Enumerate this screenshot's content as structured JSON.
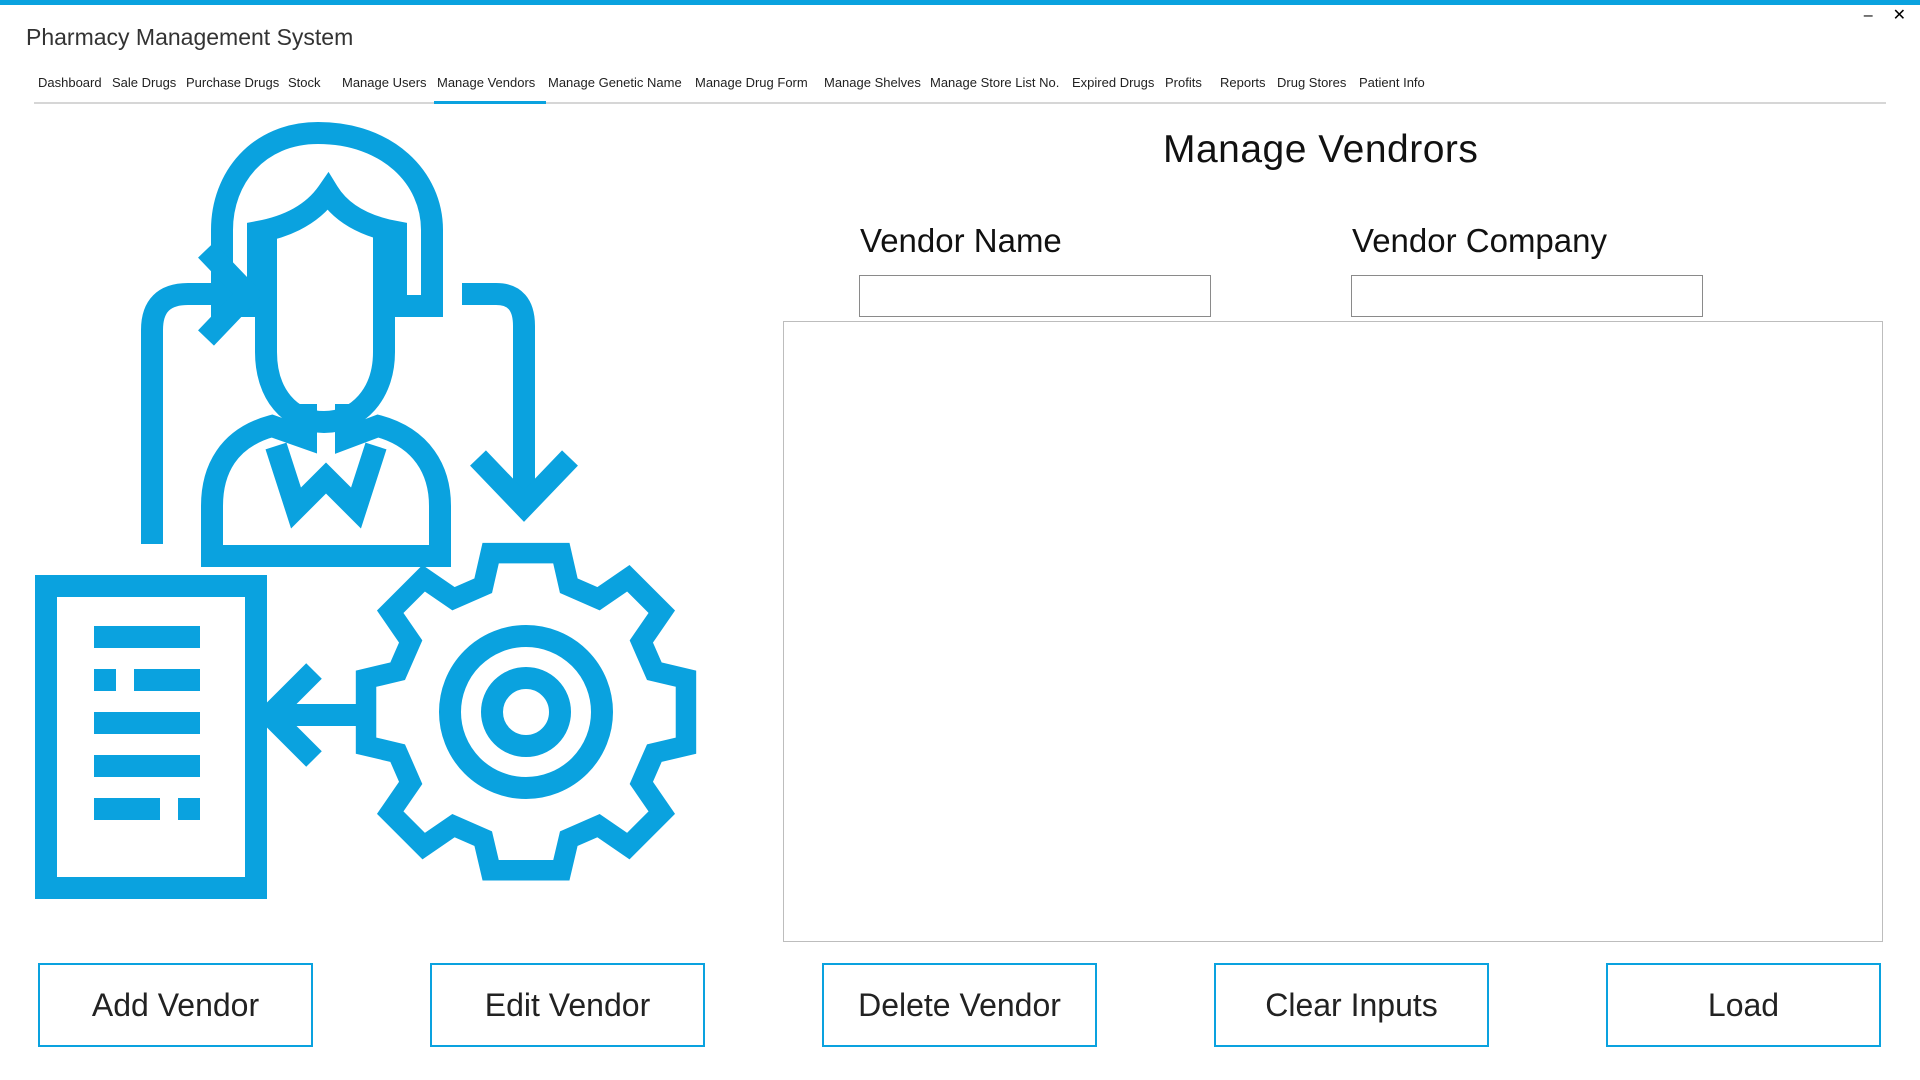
{
  "window": {
    "title": "Pharmacy Management System",
    "minimize_label": "–",
    "close_label": "✕"
  },
  "nav": {
    "items": [
      {
        "label": "Dashboard"
      },
      {
        "label": "Sale Drugs"
      },
      {
        "label": "Purchase Drugs"
      },
      {
        "label": "Stock"
      },
      {
        "label": "Manage Users"
      },
      {
        "label": "Manage Vendors",
        "active": true
      },
      {
        "label": "Manage Genetic Name"
      },
      {
        "label": "Manage Drug Form"
      },
      {
        "label": "Manage Shelves"
      },
      {
        "label": "Manage Store List No."
      },
      {
        "label": "Expired Drugs"
      },
      {
        "label": "Profits"
      },
      {
        "label": "Reports"
      },
      {
        "label": "Drug Stores"
      },
      {
        "label": "Patient Info"
      }
    ]
  },
  "form": {
    "title": "Manage Vendrors",
    "vendor_name": {
      "label": "Vendor Name",
      "value": ""
    },
    "vendor_company": {
      "label": "Vendor Company",
      "value": ""
    }
  },
  "buttons": {
    "add": "Add Vendor",
    "edit": "Edit Vendor",
    "delete": "Delete Vendor",
    "clear": "Clear Inputs",
    "load": "Load"
  },
  "colors": {
    "accent": "#0aa2df",
    "border_gray": "#bdbdbd"
  },
  "illustration": {
    "icons": [
      "person-icon",
      "gear-icon",
      "document-icon",
      "cycle-arrows-icon"
    ]
  }
}
